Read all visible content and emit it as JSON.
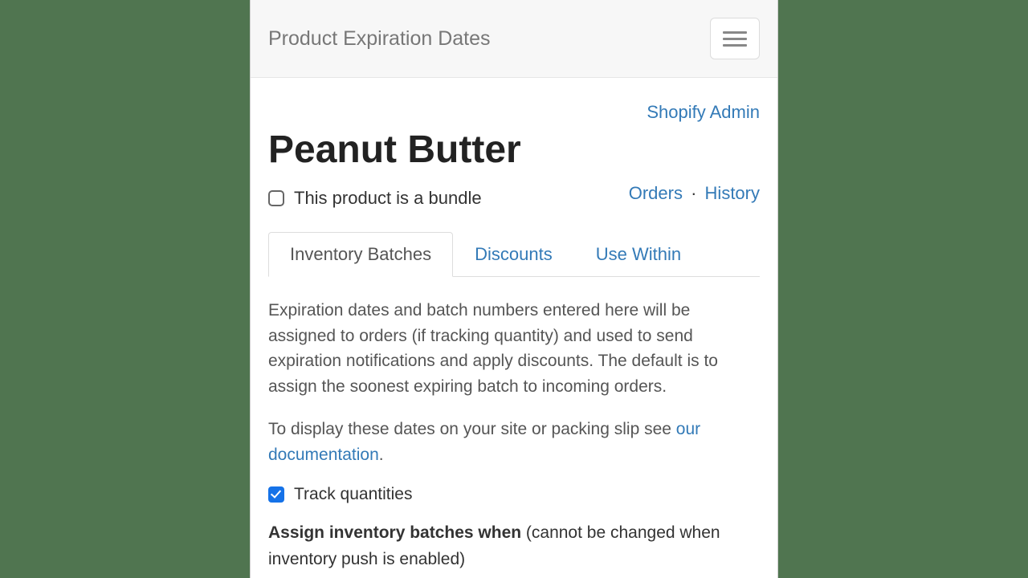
{
  "navbar": {
    "brand": "Product Expiration Dates"
  },
  "links": {
    "shopify_admin": "Shopify Admin",
    "orders": "Orders",
    "history": "History",
    "separator": "·"
  },
  "product": {
    "title": "Peanut Butter",
    "bundle_label": "This product is a bundle"
  },
  "tabs": {
    "inventory": "Inventory Batches",
    "discounts": "Discounts",
    "use_within": "Use Within"
  },
  "inventory_tab": {
    "desc1": "Expiration dates and batch numbers entered here will be assigned to orders (if tracking quantity) and used to send expiration notifications and apply discounts. The default is to assign the soonest expiring batch to incoming orders.",
    "desc2_prefix": "To display these dates on your site or packing slip see ",
    "desc2_link": "our documentation",
    "desc2_suffix": ".",
    "track_label": "Track quantities",
    "assign_bold": "Assign inventory batches when ",
    "assign_note": "(cannot be changed when inventory push is enabled)"
  }
}
